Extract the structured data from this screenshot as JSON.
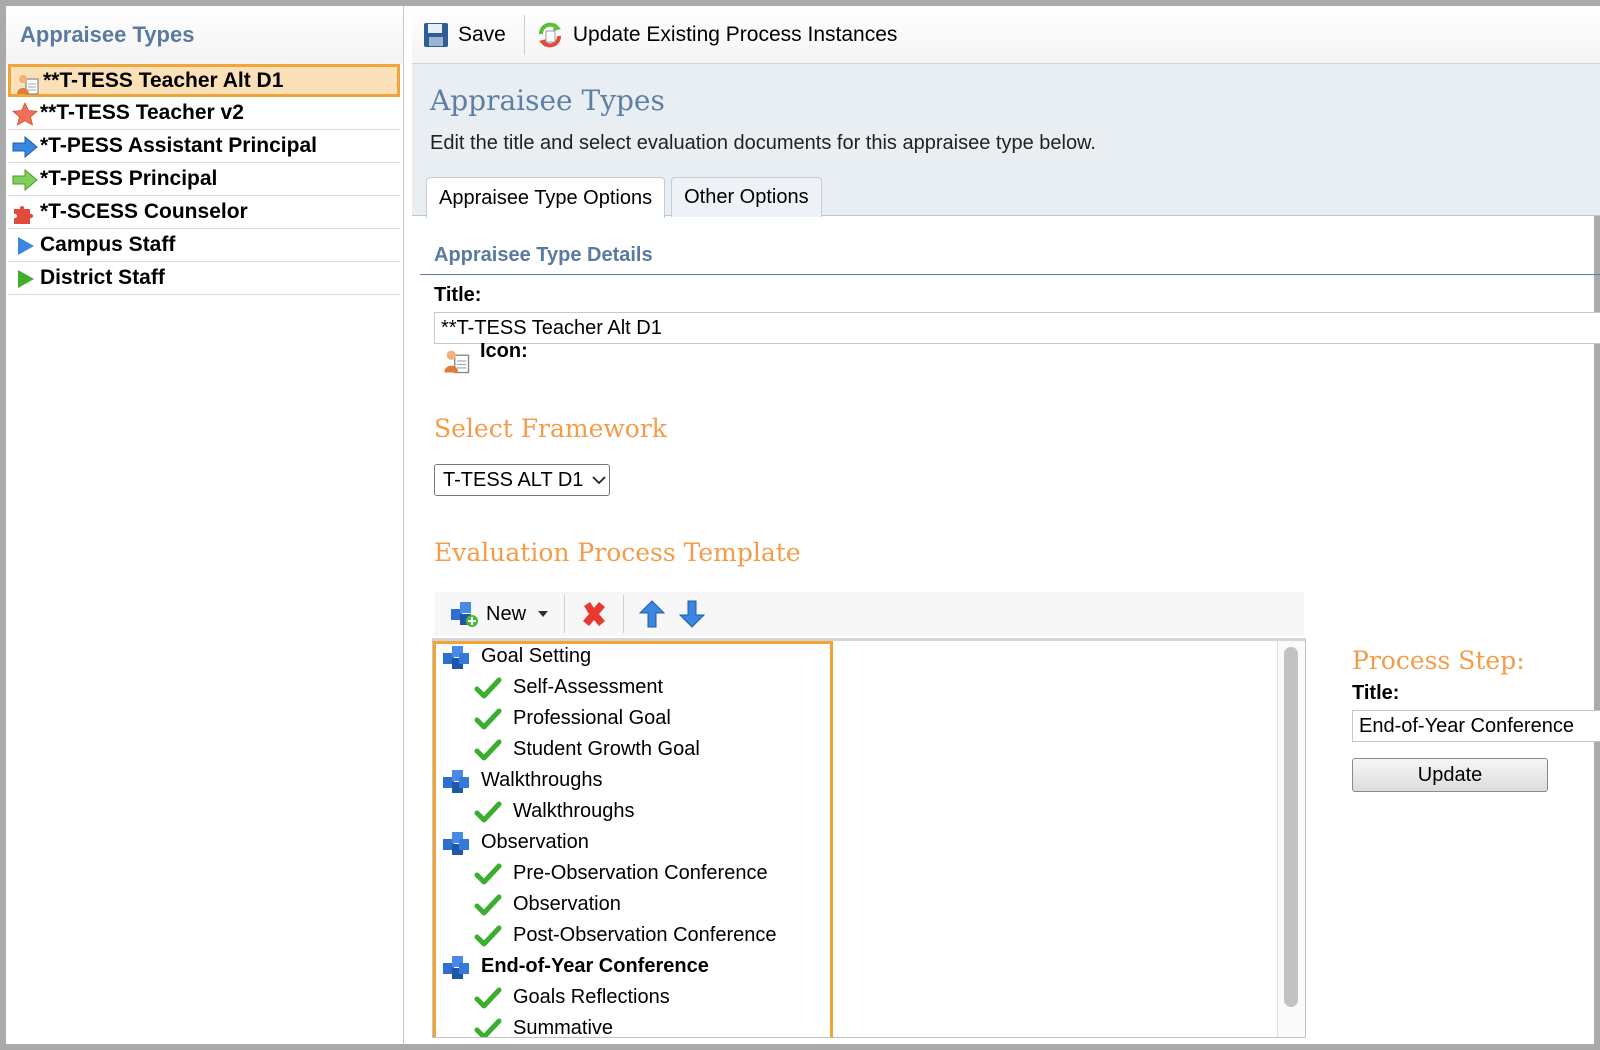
{
  "sidebar": {
    "header": "Appraisee Types",
    "items": [
      {
        "label": "**T-TESS Teacher Alt D1",
        "icon": "document-user-icon",
        "selected": true
      },
      {
        "label": "**T-TESS Teacher v2",
        "icon": "star-icon"
      },
      {
        "label": "*T-PESS Assistant Principal",
        "icon": "blue-arrow-icon"
      },
      {
        "label": "*T-PESS Principal",
        "icon": "green-arrow-icon"
      },
      {
        "label": "*T-SCESS Counselor",
        "icon": "puzzle-icon"
      },
      {
        "label": "Campus Staff",
        "icon": "blue-triangle-icon"
      },
      {
        "label": "District Staff",
        "icon": "green-triangle-icon"
      }
    ]
  },
  "toolbar": {
    "save_label": "Save",
    "update_label": "Update Existing Process Instances"
  },
  "header": {
    "title": "Appraisee Types",
    "description": "Edit the title and select evaluation documents for this appraisee type below."
  },
  "tabs": [
    {
      "label": "Appraisee Type Options",
      "active": true
    },
    {
      "label": "Other Options",
      "active": false
    }
  ],
  "details": {
    "section_title": "Appraisee Type Details",
    "title_label": "Title:",
    "title_value": "**T-TESS Teacher Alt D1",
    "icon_label": "Icon:"
  },
  "framework": {
    "heading": "Select Framework",
    "selected": "T-TESS ALT D1"
  },
  "template": {
    "heading": "Evaluation Process Template",
    "new_label": "New",
    "tree": [
      {
        "label": "Goal Setting",
        "level": 0
      },
      {
        "label": "Self-Assessment",
        "level": 1
      },
      {
        "label": "Professional Goal",
        "level": 1
      },
      {
        "label": "Student Growth Goal",
        "level": 1
      },
      {
        "label": "Walkthroughs",
        "level": 0
      },
      {
        "label": "Walkthroughs",
        "level": 1
      },
      {
        "label": "Observation",
        "level": 0
      },
      {
        "label": "Pre-Observation Conference",
        "level": 1
      },
      {
        "label": "Observation",
        "level": 1
      },
      {
        "label": "Post-Observation Conference",
        "level": 1
      },
      {
        "label": "End-of-Year Conference",
        "level": 0,
        "bold": true
      },
      {
        "label": "Goals Reflections",
        "level": 1
      },
      {
        "label": "Summative",
        "level": 1
      }
    ]
  },
  "process_step": {
    "heading": "Process Step:",
    "title_label": "Title:",
    "title_value": "End-of-Year Conference",
    "update_label": "Update"
  },
  "colors": {
    "accent_blue": "#5a7a9f",
    "accent_orange": "#f39c4a",
    "highlight_border": "#f3a331",
    "selected_bg": "#fbe0b8"
  }
}
